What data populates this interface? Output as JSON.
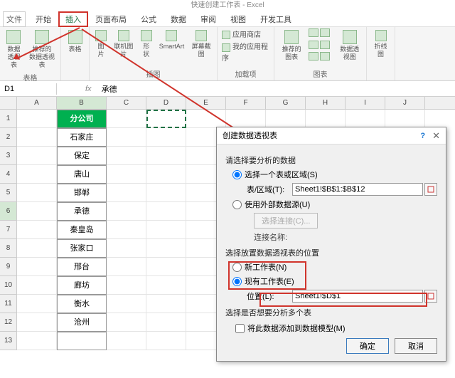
{
  "app": {
    "title_suffix": "快速创建工作表 - Excel"
  },
  "tabs": {
    "file": "文件",
    "home": "开始",
    "insert": "插入",
    "layout": "页面布局",
    "formulas": "公式",
    "data": "数据",
    "review": "审阅",
    "view": "视图",
    "developer": "开发工具"
  },
  "ribbon": {
    "pivot": "数据\n透视表",
    "rec_pivot": "推荐的\n数据透视表",
    "table": "表格",
    "pic": "图片",
    "online_pic": "联机图片",
    "shapes": "形状",
    "smartart": "SmartArt",
    "screenshot": "屏幕截图",
    "store": "应用商店",
    "myapps": "我的应用程序",
    "rec_chart": "推荐的\n图表",
    "pivot_chart": "数据透视图",
    "sparkline": "折线图",
    "grp_tables": "表格",
    "grp_illus": "插图",
    "grp_apps": "加载项",
    "grp_charts": "图表"
  },
  "namebox": "D1",
  "formula": "承德",
  "columns": [
    "A",
    "B",
    "C",
    "D",
    "E",
    "F",
    "G",
    "H",
    "I",
    "J"
  ],
  "rows": [
    "1",
    "2",
    "3",
    "4",
    "5",
    "6",
    "7",
    "8",
    "9",
    "10",
    "11",
    "12",
    "13"
  ],
  "colB_data": [
    "分公司",
    "石家庄",
    "保定",
    "唐山",
    "邯郸",
    "承德",
    "秦皇岛",
    "张家口",
    "邢台",
    "廊坊",
    "衡水",
    "沧州"
  ],
  "dialog": {
    "title": "创建数据透视表",
    "sec1": "请选择要分析的数据",
    "r1": "选择一个表或区域(S)",
    "tbl_range_label": "表/区域(T):",
    "tbl_range_value": "Sheet1!$B$1:$B$12",
    "r2": "使用外部数据源(U)",
    "choose_conn": "选择连接(C)...",
    "conn_name": "连接名称:",
    "sec2": "选择放置数据透视表的位置",
    "r3": "新工作表(N)",
    "r4": "现有工作表(E)",
    "loc_label": "位置(L):",
    "loc_value": "Sheet1!$D$1",
    "sec3": "选择是否想要分析多个表",
    "chk": "将此数据添加到数据模型(M)",
    "ok": "确定",
    "cancel": "取消"
  }
}
